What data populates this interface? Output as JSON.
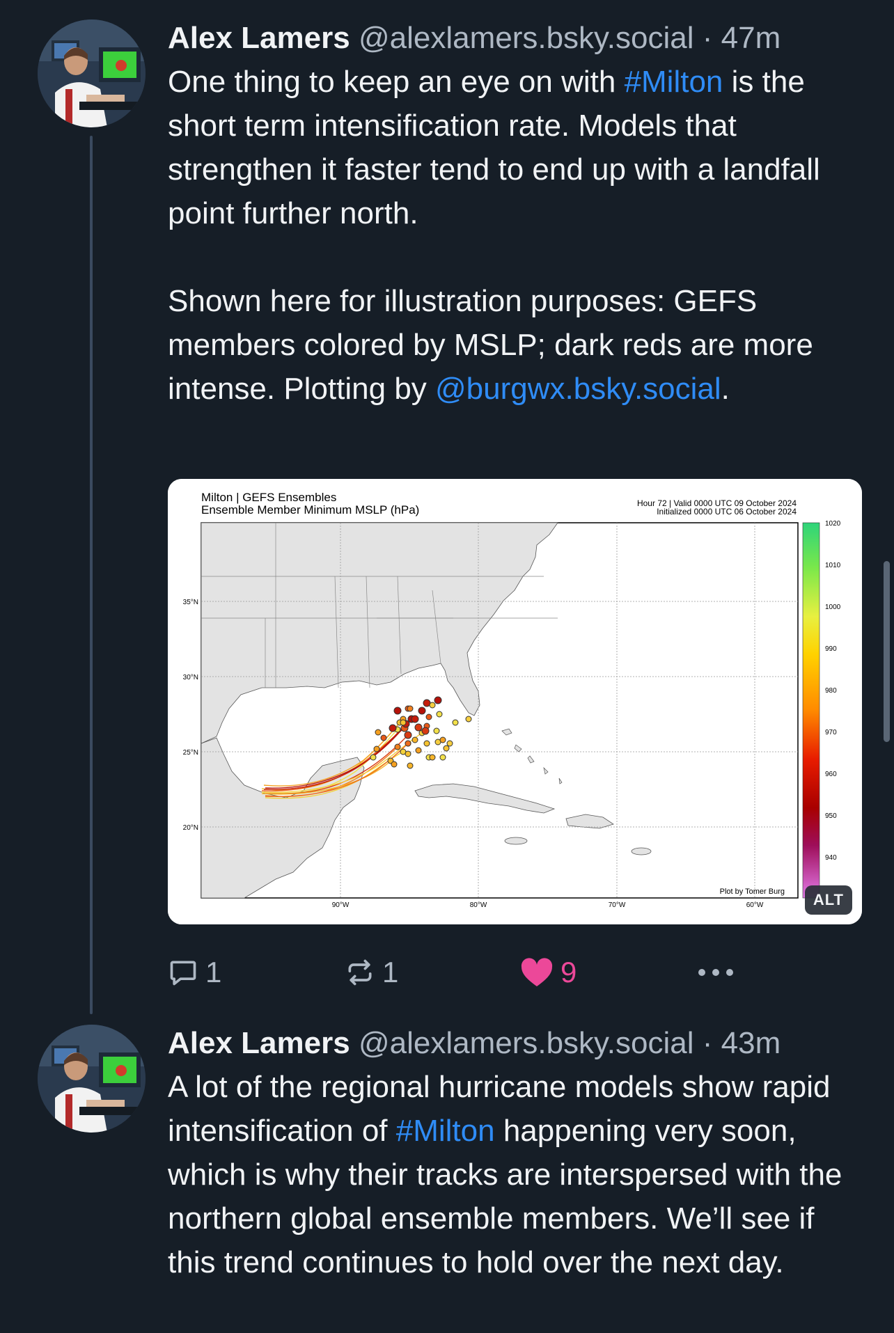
{
  "posts": [
    {
      "author_name": "Alex Lamers",
      "handle": "@alexlamers.bsky.social",
      "separator": "·",
      "time": "47m",
      "text": {
        "p1_a": "One thing to keep an eye on with ",
        "p1_tag": "#Milton",
        "p1_b": " is the short term intensification rate. Models that strengthen it faster tend to end up with a landfall point further north.",
        "p2_a": "Shown here for illustration purposes: GEFS members colored by MSLP; dark reds are more intense. Plotting by ",
        "p2_mention": "@burgwx.bsky.social",
        "p2_b": "."
      },
      "embed": {
        "alt_label": "ALT",
        "title_line1": "Milton | GEFS Ensembles",
        "title_line2": "Ensemble Member Minimum MSLP (hPa)",
        "valid_line1": "Hour 72 | Valid 0000 UTC 09 October 2024",
        "valid_line2": "Initialized 0000 UTC 06 October 2024",
        "credit": "Plot by Tomer Burg",
        "lat_labels": [
          "35°N",
          "30°N",
          "25°N",
          "20°N"
        ],
        "lon_labels": [
          "90°W",
          "80°W",
          "70°W",
          "60°W"
        ],
        "colorbar_labels": [
          "1020",
          "1010",
          "1000",
          "990",
          "980",
          "970",
          "960",
          "950",
          "940"
        ]
      },
      "actions": {
        "reply_count": "1",
        "repost_count": "1",
        "like_count": "9"
      }
    },
    {
      "author_name": "Alex Lamers",
      "handle": "@alexlamers.bsky.social",
      "separator": "·",
      "time": "43m",
      "text": {
        "a": "A lot of the regional hurricane models show rapid intensification of ",
        "tag": "#Milton",
        "b": " happening very soon, which is why their tracks are interspersed with the northern global ensemble members. We’ll see if this trend continues to hold over the next day."
      }
    }
  ],
  "colors": {
    "background": "#161e27",
    "link": "#2f8cf6",
    "like": "#ec4899",
    "muted": "#aeb8c4"
  },
  "icons": [
    "reply-icon",
    "repost-icon",
    "heart-icon",
    "more-icon"
  ]
}
